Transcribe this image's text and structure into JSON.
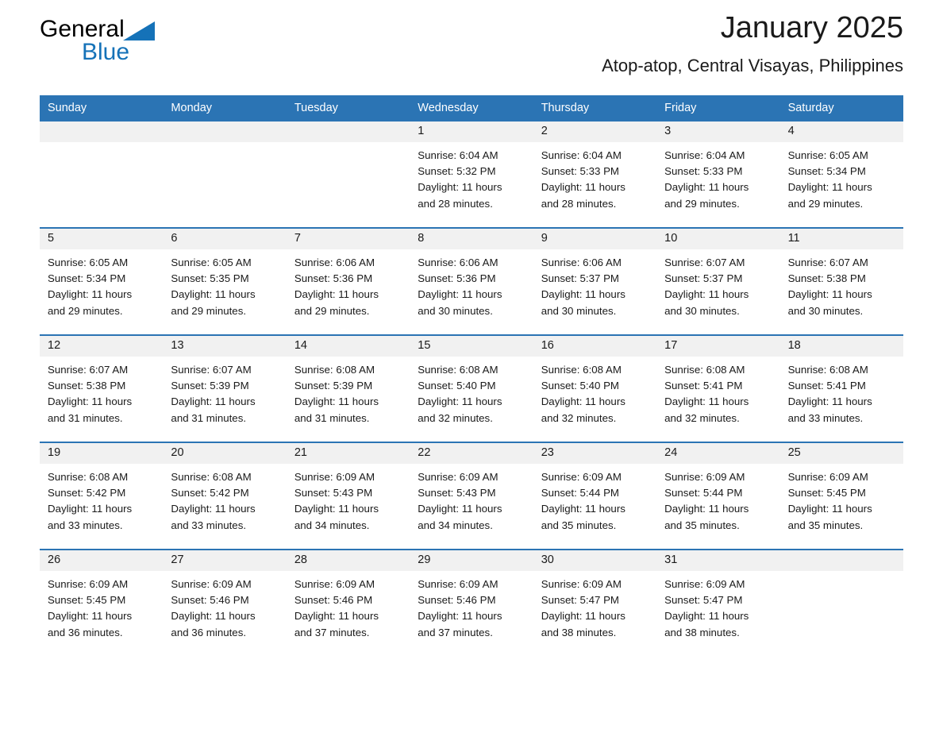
{
  "brand": {
    "word1": "General",
    "word2": "Blue"
  },
  "header": {
    "title": "January 2025",
    "subtitle": "Atop-atop, Central Visayas, Philippines"
  },
  "theme": {
    "header_blue": "#2b74b4",
    "logo_blue": "#1572b8",
    "day_band": "#f1f1f1",
    "text": "#1a1a1a"
  },
  "weekdays": [
    "Sunday",
    "Monday",
    "Tuesday",
    "Wednesday",
    "Thursday",
    "Friday",
    "Saturday"
  ],
  "weeks": [
    [
      {
        "day": "",
        "lines": []
      },
      {
        "day": "",
        "lines": []
      },
      {
        "day": "",
        "lines": []
      },
      {
        "day": "1",
        "lines": [
          "Sunrise: 6:04 AM",
          "Sunset: 5:32 PM",
          "Daylight: 11 hours",
          "and 28 minutes."
        ]
      },
      {
        "day": "2",
        "lines": [
          "Sunrise: 6:04 AM",
          "Sunset: 5:33 PM",
          "Daylight: 11 hours",
          "and 28 minutes."
        ]
      },
      {
        "day": "3",
        "lines": [
          "Sunrise: 6:04 AM",
          "Sunset: 5:33 PM",
          "Daylight: 11 hours",
          "and 29 minutes."
        ]
      },
      {
        "day": "4",
        "lines": [
          "Sunrise: 6:05 AM",
          "Sunset: 5:34 PM",
          "Daylight: 11 hours",
          "and 29 minutes."
        ]
      }
    ],
    [
      {
        "day": "5",
        "lines": [
          "Sunrise: 6:05 AM",
          "Sunset: 5:34 PM",
          "Daylight: 11 hours",
          "and 29 minutes."
        ]
      },
      {
        "day": "6",
        "lines": [
          "Sunrise: 6:05 AM",
          "Sunset: 5:35 PM",
          "Daylight: 11 hours",
          "and 29 minutes."
        ]
      },
      {
        "day": "7",
        "lines": [
          "Sunrise: 6:06 AM",
          "Sunset: 5:36 PM",
          "Daylight: 11 hours",
          "and 29 minutes."
        ]
      },
      {
        "day": "8",
        "lines": [
          "Sunrise: 6:06 AM",
          "Sunset: 5:36 PM",
          "Daylight: 11 hours",
          "and 30 minutes."
        ]
      },
      {
        "day": "9",
        "lines": [
          "Sunrise: 6:06 AM",
          "Sunset: 5:37 PM",
          "Daylight: 11 hours",
          "and 30 minutes."
        ]
      },
      {
        "day": "10",
        "lines": [
          "Sunrise: 6:07 AM",
          "Sunset: 5:37 PM",
          "Daylight: 11 hours",
          "and 30 minutes."
        ]
      },
      {
        "day": "11",
        "lines": [
          "Sunrise: 6:07 AM",
          "Sunset: 5:38 PM",
          "Daylight: 11 hours",
          "and 30 minutes."
        ]
      }
    ],
    [
      {
        "day": "12",
        "lines": [
          "Sunrise: 6:07 AM",
          "Sunset: 5:38 PM",
          "Daylight: 11 hours",
          "and 31 minutes."
        ]
      },
      {
        "day": "13",
        "lines": [
          "Sunrise: 6:07 AM",
          "Sunset: 5:39 PM",
          "Daylight: 11 hours",
          "and 31 minutes."
        ]
      },
      {
        "day": "14",
        "lines": [
          "Sunrise: 6:08 AM",
          "Sunset: 5:39 PM",
          "Daylight: 11 hours",
          "and 31 minutes."
        ]
      },
      {
        "day": "15",
        "lines": [
          "Sunrise: 6:08 AM",
          "Sunset: 5:40 PM",
          "Daylight: 11 hours",
          "and 32 minutes."
        ]
      },
      {
        "day": "16",
        "lines": [
          "Sunrise: 6:08 AM",
          "Sunset: 5:40 PM",
          "Daylight: 11 hours",
          "and 32 minutes."
        ]
      },
      {
        "day": "17",
        "lines": [
          "Sunrise: 6:08 AM",
          "Sunset: 5:41 PM",
          "Daylight: 11 hours",
          "and 32 minutes."
        ]
      },
      {
        "day": "18",
        "lines": [
          "Sunrise: 6:08 AM",
          "Sunset: 5:41 PM",
          "Daylight: 11 hours",
          "and 33 minutes."
        ]
      }
    ],
    [
      {
        "day": "19",
        "lines": [
          "Sunrise: 6:08 AM",
          "Sunset: 5:42 PM",
          "Daylight: 11 hours",
          "and 33 minutes."
        ]
      },
      {
        "day": "20",
        "lines": [
          "Sunrise: 6:08 AM",
          "Sunset: 5:42 PM",
          "Daylight: 11 hours",
          "and 33 minutes."
        ]
      },
      {
        "day": "21",
        "lines": [
          "Sunrise: 6:09 AM",
          "Sunset: 5:43 PM",
          "Daylight: 11 hours",
          "and 34 minutes."
        ]
      },
      {
        "day": "22",
        "lines": [
          "Sunrise: 6:09 AM",
          "Sunset: 5:43 PM",
          "Daylight: 11 hours",
          "and 34 minutes."
        ]
      },
      {
        "day": "23",
        "lines": [
          "Sunrise: 6:09 AM",
          "Sunset: 5:44 PM",
          "Daylight: 11 hours",
          "and 35 minutes."
        ]
      },
      {
        "day": "24",
        "lines": [
          "Sunrise: 6:09 AM",
          "Sunset: 5:44 PM",
          "Daylight: 11 hours",
          "and 35 minutes."
        ]
      },
      {
        "day": "25",
        "lines": [
          "Sunrise: 6:09 AM",
          "Sunset: 5:45 PM",
          "Daylight: 11 hours",
          "and 35 minutes."
        ]
      }
    ],
    [
      {
        "day": "26",
        "lines": [
          "Sunrise: 6:09 AM",
          "Sunset: 5:45 PM",
          "Daylight: 11 hours",
          "and 36 minutes."
        ]
      },
      {
        "day": "27",
        "lines": [
          "Sunrise: 6:09 AM",
          "Sunset: 5:46 PM",
          "Daylight: 11 hours",
          "and 36 minutes."
        ]
      },
      {
        "day": "28",
        "lines": [
          "Sunrise: 6:09 AM",
          "Sunset: 5:46 PM",
          "Daylight: 11 hours",
          "and 37 minutes."
        ]
      },
      {
        "day": "29",
        "lines": [
          "Sunrise: 6:09 AM",
          "Sunset: 5:46 PM",
          "Daylight: 11 hours",
          "and 37 minutes."
        ]
      },
      {
        "day": "30",
        "lines": [
          "Sunrise: 6:09 AM",
          "Sunset: 5:47 PM",
          "Daylight: 11 hours",
          "and 38 minutes."
        ]
      },
      {
        "day": "31",
        "lines": [
          "Sunrise: 6:09 AM",
          "Sunset: 5:47 PM",
          "Daylight: 11 hours",
          "and 38 minutes."
        ]
      },
      {
        "day": "",
        "lines": []
      }
    ]
  ]
}
